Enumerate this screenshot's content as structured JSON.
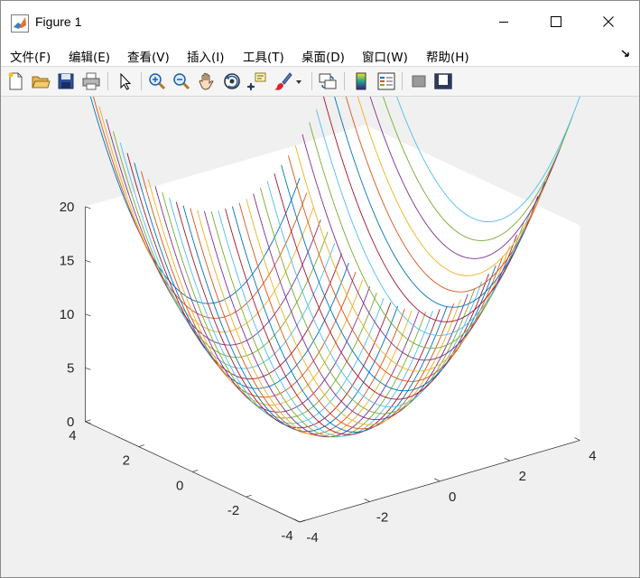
{
  "window": {
    "title": "Figure 1",
    "icon": "matlab-logo-icon",
    "controls": [
      "minimize-icon",
      "maximize-icon",
      "close-icon"
    ]
  },
  "menu": {
    "items": [
      {
        "label": "文件(F)",
        "key": "F"
      },
      {
        "label": "编辑(E)",
        "key": "E"
      },
      {
        "label": "查看(V)",
        "key": "V"
      },
      {
        "label": "插入(I)",
        "key": "I"
      },
      {
        "label": "工具(T)",
        "key": "T"
      },
      {
        "label": "桌面(D)",
        "key": "D"
      },
      {
        "label": "窗口(W)",
        "key": "W"
      },
      {
        "label": "帮助(H)",
        "key": "H"
      }
    ],
    "overflow_icon": "dock-arrow-icon"
  },
  "toolbar": {
    "buttons": [
      "new-figure-icon",
      "open-file-icon",
      "save-icon",
      "print-icon",
      "select-pointer-icon",
      "zoom-in-icon",
      "zoom-out-icon",
      "pan-hand-icon",
      "rotate-3d-icon",
      "data-cursor-icon",
      "brush-icon",
      "brush-dropdown-icon",
      "link-plot-icon",
      "colorbar-icon",
      "legend-icon",
      "hide-plot-tools-icon",
      "show-plot-tools-icon"
    ]
  },
  "chart_data": {
    "type": "mesh-3d",
    "function": "z = x^2 + y^2",
    "x": [
      -4,
      4
    ],
    "y": [
      -4,
      4
    ],
    "z_range": [
      0,
      20
    ],
    "line_count": 41,
    "xticks": [
      -4,
      -2,
      0,
      2,
      4
    ],
    "yticks": [
      -4,
      -2,
      0,
      2,
      4
    ],
    "zticks": [
      0,
      5,
      10,
      15,
      20
    ],
    "xtick_labels": [
      "-4",
      "-2",
      "0",
      "2",
      "4"
    ],
    "ytick_labels": [
      "-4",
      "-2",
      "0",
      "2",
      "4"
    ],
    "ztick_labels": [
      "0",
      "5",
      "10",
      "15",
      "20"
    ],
    "colors": [
      "#0072BD",
      "#D95319",
      "#EDB120",
      "#7E2F8E",
      "#77AC30",
      "#4DBEEE",
      "#A2142F"
    ],
    "grid": false,
    "view": "default 3-D"
  }
}
